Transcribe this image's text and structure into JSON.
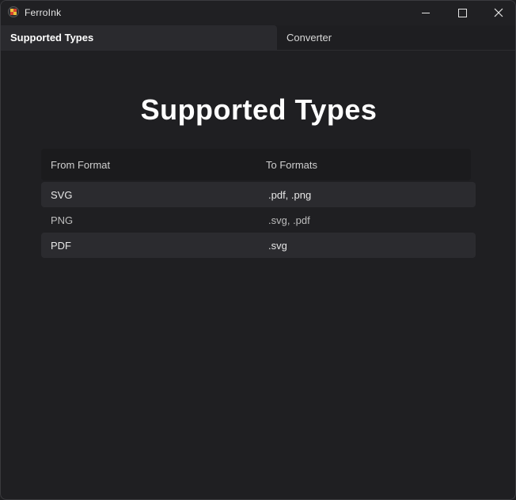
{
  "window": {
    "title": "FerroInk"
  },
  "tabs": [
    {
      "label": "Supported Types",
      "active": true
    },
    {
      "label": "Converter",
      "active": false
    }
  ],
  "main": {
    "heading": "Supported Types",
    "table": {
      "columns": [
        "From Format",
        "To Formats"
      ],
      "rows": [
        {
          "from": "SVG",
          "to": ".pdf, .png"
        },
        {
          "from": "PNG",
          "to": ".svg, .pdf"
        },
        {
          "from": "PDF",
          "to": ".svg"
        }
      ]
    }
  },
  "colors": {
    "background": "#1f1f22",
    "row_highlight": "#2b2b2f",
    "header_background": "#1b1b1d"
  }
}
